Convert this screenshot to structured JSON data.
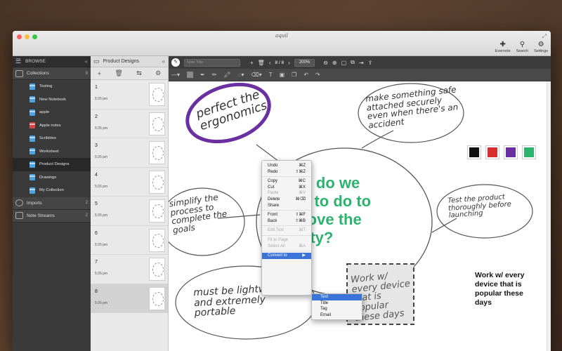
{
  "app": {
    "title": "aquil"
  },
  "top_actions": [
    {
      "label": "Evernote",
      "icon": "evernote-icon"
    },
    {
      "label": "Search",
      "icon": "search-icon"
    },
    {
      "label": "Settings",
      "icon": "gear-icon"
    }
  ],
  "sidebar": {
    "header": "BROWSE",
    "collections": {
      "label": "Collections",
      "count": "9"
    },
    "items": [
      {
        "label": "Testing",
        "color": "#4fa3e0"
      },
      {
        "label": "New Notebook",
        "color": "#4fa3e0"
      },
      {
        "label": "apple",
        "color": "#4fa3e0"
      },
      {
        "label": "Apple notes",
        "color": "#d64545"
      },
      {
        "label": "Scribbles",
        "color": "#4fa3e0"
      },
      {
        "label": "Worksheet",
        "color": "#4fa3e0"
      },
      {
        "label": "Product Designs",
        "color": "#4fa3e0"
      },
      {
        "label": "Drawings",
        "color": "#4fa3e0"
      },
      {
        "label": "My Collection",
        "color": "#4fa3e0"
      }
    ],
    "imports": {
      "label": "Imports",
      "count": "2"
    },
    "note_streams": {
      "label": "Note Streams",
      "count": "2"
    }
  },
  "notelist": {
    "title": "Product Designs",
    "notes": [
      {
        "num": "1",
        "time": "5:26 pm"
      },
      {
        "num": "2",
        "time": "5:26 pm"
      },
      {
        "num": "3",
        "time": "5:26 pm"
      },
      {
        "num": "4",
        "time": "5:26 pm"
      },
      {
        "num": "5",
        "time": "5:26 pm"
      },
      {
        "num": "6",
        "time": "5:26 pm"
      },
      {
        "num": "7",
        "time": "5:26 pm"
      },
      {
        "num": "8",
        "time": "5:26 pm"
      }
    ]
  },
  "editor": {
    "title_placeholder": "Note Title",
    "page_indicator": "8 / 8",
    "zoom": "200%",
    "color_swatches": [
      "#111111",
      "#d62e2e",
      "#6a2fa0",
      "#2db36f"
    ]
  },
  "canvas": {
    "question": "What do we need to do to improve the quality?",
    "hw_ergonomics": "perfect the ergonomics",
    "hw_safe": "make something safe attached securely even when there's an accident",
    "hw_simplify": "simplify the process to complete the goals",
    "hw_test": "Test the product thoroughly before launching",
    "hw_lightweight": "must be lightweight and extremely portable",
    "hw_selected": "Work w/ every device that is popular these days",
    "work_text": "Work w/ every device that is popular these days"
  },
  "context_menu": {
    "items": [
      {
        "label": "Undo",
        "shortcut": "⌘Z",
        "disabled": false
      },
      {
        "label": "Redo",
        "shortcut": "⇧⌘Z",
        "disabled": false
      },
      {
        "sep": true
      },
      {
        "label": "Copy",
        "shortcut": "⌘C",
        "disabled": false
      },
      {
        "label": "Cut",
        "shortcut": "⌘X",
        "disabled": false
      },
      {
        "label": "Paste",
        "shortcut": "⌘V",
        "disabled": true
      },
      {
        "label": "Delete",
        "shortcut": "⌘⌫",
        "disabled": false
      },
      {
        "label": "Share",
        "shortcut": "",
        "disabled": false
      },
      {
        "sep": true
      },
      {
        "label": "Front",
        "shortcut": "⇧⌘F",
        "disabled": false
      },
      {
        "label": "Back",
        "shortcut": "⇧⌘B",
        "disabled": false
      },
      {
        "sep": true
      },
      {
        "label": "Edit Text",
        "shortcut": "⌘T",
        "disabled": true
      },
      {
        "sep": true
      },
      {
        "label": "Fit to Page",
        "shortcut": "",
        "disabled": true
      },
      {
        "label": "Select All",
        "shortcut": "⌘A",
        "disabled": true
      },
      {
        "sep": true
      },
      {
        "label": "Convert to",
        "shortcut": "▶",
        "disabled": false,
        "highlight": true
      }
    ],
    "submenu": [
      "Text",
      "Title",
      "Tag",
      "Email"
    ]
  }
}
